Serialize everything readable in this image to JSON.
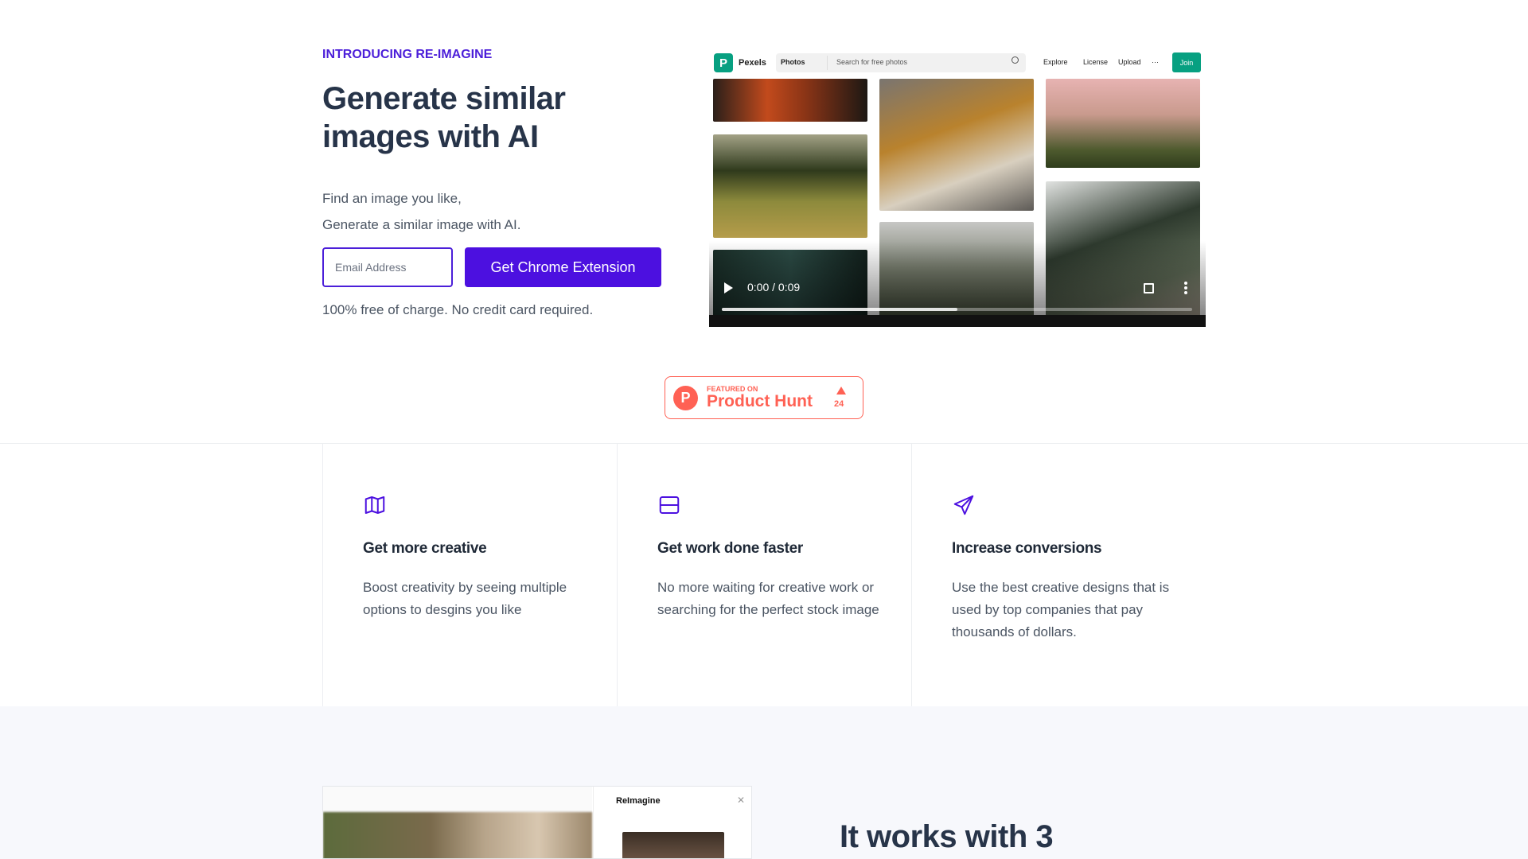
{
  "hero": {
    "eyebrow": "INTRODUCING RE-IMAGINE",
    "title": "Generate similar images with AI",
    "desc_line1": "Find an image you like,",
    "desc_line2": "Generate a similar image with AI.",
    "email_placeholder": "Email Address",
    "cta_label": "Get Chrome Extension",
    "free_note": "100% free of charge. No credit card required."
  },
  "video": {
    "time": "0:00 / 0:09",
    "progress": 0.5,
    "pexels": {
      "logo_letter": "P",
      "name": "Pexels",
      "photos_label": "Photos",
      "search_placeholder": "Search for free photos",
      "explore": "Explore",
      "license": "License",
      "upload": "Upload",
      "more": "···",
      "join": "Join"
    }
  },
  "product_hunt": {
    "featured": "FEATURED ON",
    "name": "Product Hunt",
    "count": "24",
    "color": "#ff6154"
  },
  "features": [
    {
      "icon": "map-icon",
      "title": "Get more creative",
      "desc": "Boost creativity by seeing multiple options to desgins you like"
    },
    {
      "icon": "server-icon",
      "title": "Get work done faster",
      "desc": "No more waiting for creative work or searching for the perfect stock image"
    },
    {
      "icon": "send-icon",
      "title": "Increase conversions",
      "desc": "Use the best creative designs that is used by top companies that pay thousands of dollars."
    }
  ],
  "bottom": {
    "panel_title": "ReImagine",
    "close": "✕",
    "works_title": "It works with 3"
  },
  "colors": {
    "accent": "#4c10e0",
    "heading": "#273449",
    "pexels_green": "#07a081"
  }
}
